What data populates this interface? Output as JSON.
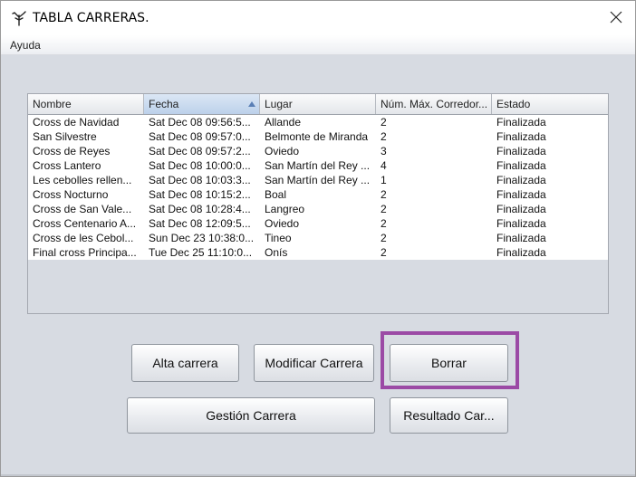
{
  "window": {
    "title": "TABLA CARRERAS.",
    "icon": "tree-branch-icon",
    "close_icon": "close-icon"
  },
  "menubar": {
    "items": [
      {
        "label": "Ayuda"
      }
    ]
  },
  "table": {
    "columns": [
      {
        "label": "Nombre"
      },
      {
        "label": "Fecha",
        "sorted": "ascending"
      },
      {
        "label": "Lugar"
      },
      {
        "label": "Núm. Máx. Corredor..."
      },
      {
        "label": "Estado"
      }
    ],
    "rows": [
      [
        "Cross de Navidad",
        "Sat Dec 08 09:56:5...",
        "Allande",
        "2",
        "Finalizada"
      ],
      [
        "San Silvestre",
        "Sat Dec 08 09:57:0...",
        "Belmonte de Miranda",
        "2",
        "Finalizada"
      ],
      [
        "Cross de Reyes",
        "Sat Dec 08 09:57:2...",
        "Oviedo",
        "3",
        "Finalizada"
      ],
      [
        "Cross Lantero",
        "Sat Dec 08 10:00:0...",
        "San Martín del Rey ...",
        "4",
        "Finalizada"
      ],
      [
        "Les cebolles rellen...",
        "Sat Dec 08 10:03:3...",
        "San Martín del Rey ...",
        "1",
        "Finalizada"
      ],
      [
        "Cross Nocturno",
        "Sat Dec 08 10:15:2...",
        "Boal",
        "2",
        "Finalizada"
      ],
      [
        "Cross de San Vale...",
        "Sat Dec 08 10:28:4...",
        "Langreo",
        "2",
        "Finalizada"
      ],
      [
        "Cross Centenario A...",
        "Sat Dec 08 12:09:5...",
        "Oviedo",
        "2",
        "Finalizada"
      ],
      [
        "Cross de les Cebol...",
        "Sun Dec 23 10:38:0...",
        "Tineo",
        "2",
        "Finalizada"
      ],
      [
        "Final cross Principa...",
        "Tue Dec 25 11:10:0...",
        "Onís",
        "2",
        "Finalizada"
      ]
    ]
  },
  "buttons": {
    "alta": "Alta carrera",
    "modificar": "Modificar Carrera",
    "borrar": "Borrar",
    "gestion": "Gestión Carrera",
    "resultado": "Resultado Car..."
  },
  "colors": {
    "highlight": "#9b4aa5",
    "panel_bg": "#d7dbe2"
  }
}
